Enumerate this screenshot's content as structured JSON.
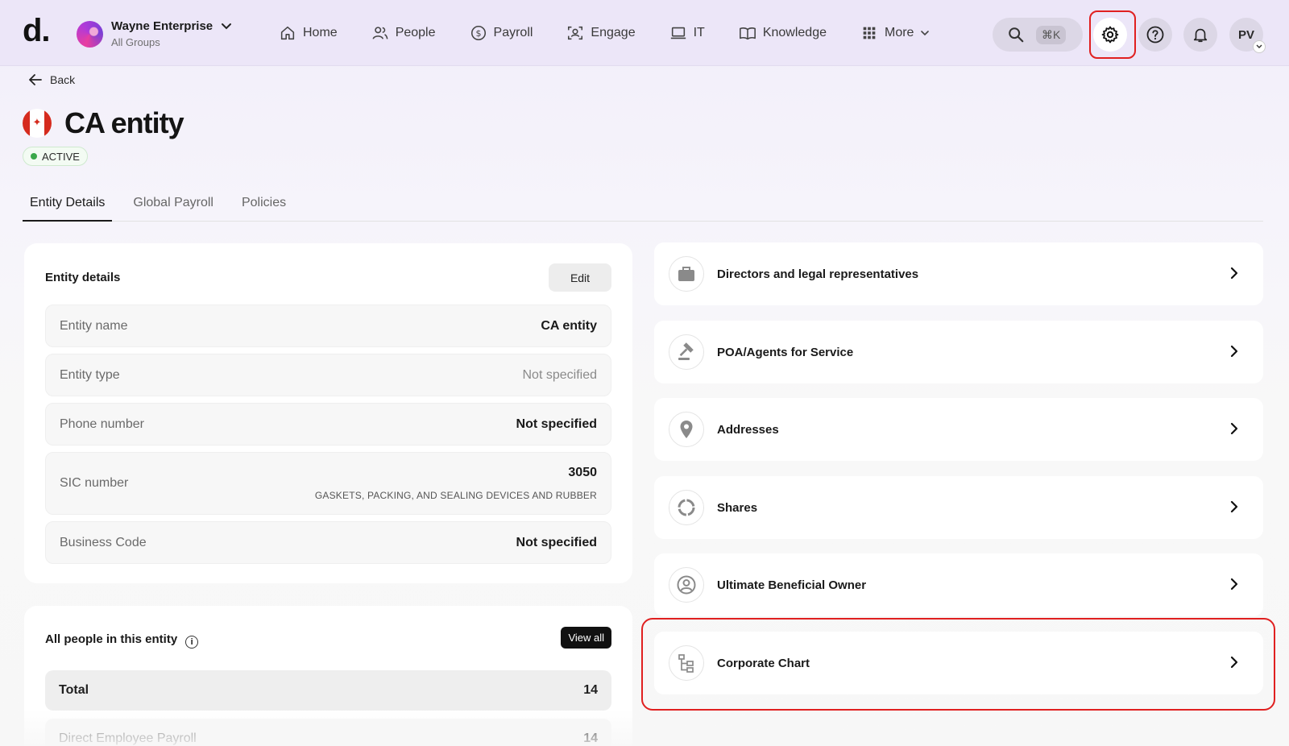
{
  "topbar": {
    "logo": "d.",
    "company_name": "Wayne Enterprise",
    "company_sub": "All Groups",
    "nav": [
      {
        "label": "Home",
        "icon": "home-icon"
      },
      {
        "label": "People",
        "icon": "people-icon"
      },
      {
        "label": "Payroll",
        "icon": "dollar-circle-icon"
      },
      {
        "label": "Engage",
        "icon": "engage-icon"
      },
      {
        "label": "IT",
        "icon": "laptop-icon"
      },
      {
        "label": "Knowledge",
        "icon": "book-icon"
      },
      {
        "label": "More",
        "icon": "grid-icon"
      }
    ],
    "search_shortcut": "⌘K",
    "avatar_initials": "PV"
  },
  "header": {
    "back_label": "Back",
    "title": "CA entity",
    "status": "ACTIVE"
  },
  "tabs": [
    "Entity Details",
    "Global Payroll",
    "Policies"
  ],
  "entity_details": {
    "heading": "Entity details",
    "edit_label": "Edit",
    "rows": [
      {
        "label": "Entity name",
        "value": "CA entity"
      },
      {
        "label": "Entity type",
        "value": "Not specified"
      },
      {
        "label": "Phone number",
        "value": "Not specified"
      },
      {
        "label": "SIC number",
        "value": "3050",
        "sub": "GASKETS, PACKING, AND SEALING DEVICES AND RUBBER"
      },
      {
        "label": "Business Code",
        "value": "Not specified"
      }
    ]
  },
  "people": {
    "heading": "All people in this entity",
    "view_all_label": "View all",
    "rows": [
      {
        "label": "Total",
        "value": "14"
      },
      {
        "label": "Direct Employee Payroll",
        "value": "14"
      }
    ]
  },
  "links": [
    {
      "label": "Directors and legal representatives",
      "icon": "briefcase-icon"
    },
    {
      "label": "POA/Agents for Service",
      "icon": "gavel-icon"
    },
    {
      "label": "Addresses",
      "icon": "location-pin-icon"
    },
    {
      "label": "Shares",
      "icon": "shares-icon"
    },
    {
      "label": "Ultimate Beneficial Owner",
      "icon": "user-circle-icon"
    },
    {
      "label": "Corporate Chart",
      "icon": "org-chart-icon"
    }
  ],
  "colors": {
    "topbar_bg": "#ece6f8",
    "highlight_red": "#e02020",
    "status_green": "#3aa84a"
  }
}
